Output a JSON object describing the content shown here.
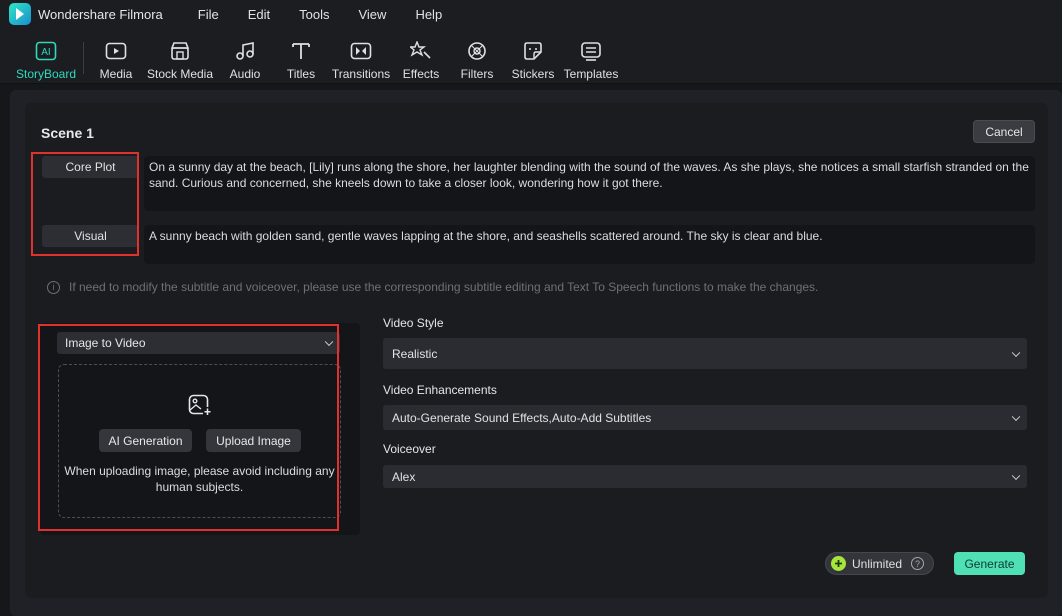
{
  "app": {
    "title": "Wondershare Filmora"
  },
  "menu": [
    "File",
    "Edit",
    "Tools",
    "View",
    "Help"
  ],
  "toolbar": {
    "items": [
      {
        "label": "StoryBoard",
        "icon": "ai-storyboard-icon",
        "active": true
      },
      {
        "label": "Media",
        "icon": "media-icon"
      },
      {
        "label": "Stock Media",
        "icon": "stock-media-icon"
      },
      {
        "label": "Audio",
        "icon": "audio-icon"
      },
      {
        "label": "Titles",
        "icon": "titles-icon"
      },
      {
        "label": "Transitions",
        "icon": "transitions-icon"
      },
      {
        "label": "Effects",
        "icon": "effects-icon"
      },
      {
        "label": "Filters",
        "icon": "filters-icon"
      },
      {
        "label": "Stickers",
        "icon": "stickers-icon"
      },
      {
        "label": "Templates",
        "icon": "templates-icon"
      }
    ],
    "accent": "#2fd9bd"
  },
  "scene": {
    "title": "Scene 1",
    "cancel_label": "Cancel",
    "core_plot_label": "Core Plot",
    "core_plot_text": "On a sunny day at the beach, [Lily] runs along the shore, her laughter blending with the sound of the waves. As she plays, she notices a small starfish stranded on the sand. Curious and concerned, she kneels down to take a closer look, wondering how it got there.",
    "visual_label": "Visual",
    "visual_text": "A sunny beach with golden sand, gentle waves lapping at the shore, and seashells scattered around. The sky is clear and blue.",
    "notice": "If need to modify the subtitle and voiceover, please use the corresponding subtitle editing and Text To Speech functions to make the changes."
  },
  "left": {
    "mode_select": "Image to Video",
    "ai_generation_label": "AI Generation",
    "upload_image_label": "Upload Image",
    "hint": "When uploading image, please avoid including any human subjects."
  },
  "right": {
    "video_style_label": "Video Style",
    "video_style_value": "Realistic",
    "enhancements_label": "Video Enhancements",
    "enhancements_value": "Auto-Generate Sound Effects,Auto-Add Subtitles",
    "voiceover_label": "Voiceover",
    "voiceover_value": "Alex"
  },
  "footer": {
    "unlimited_label": "Unlimited",
    "generate_label": "Generate"
  },
  "colors": {
    "highlight": "#e0312d",
    "generate": "#4fe0b5"
  }
}
